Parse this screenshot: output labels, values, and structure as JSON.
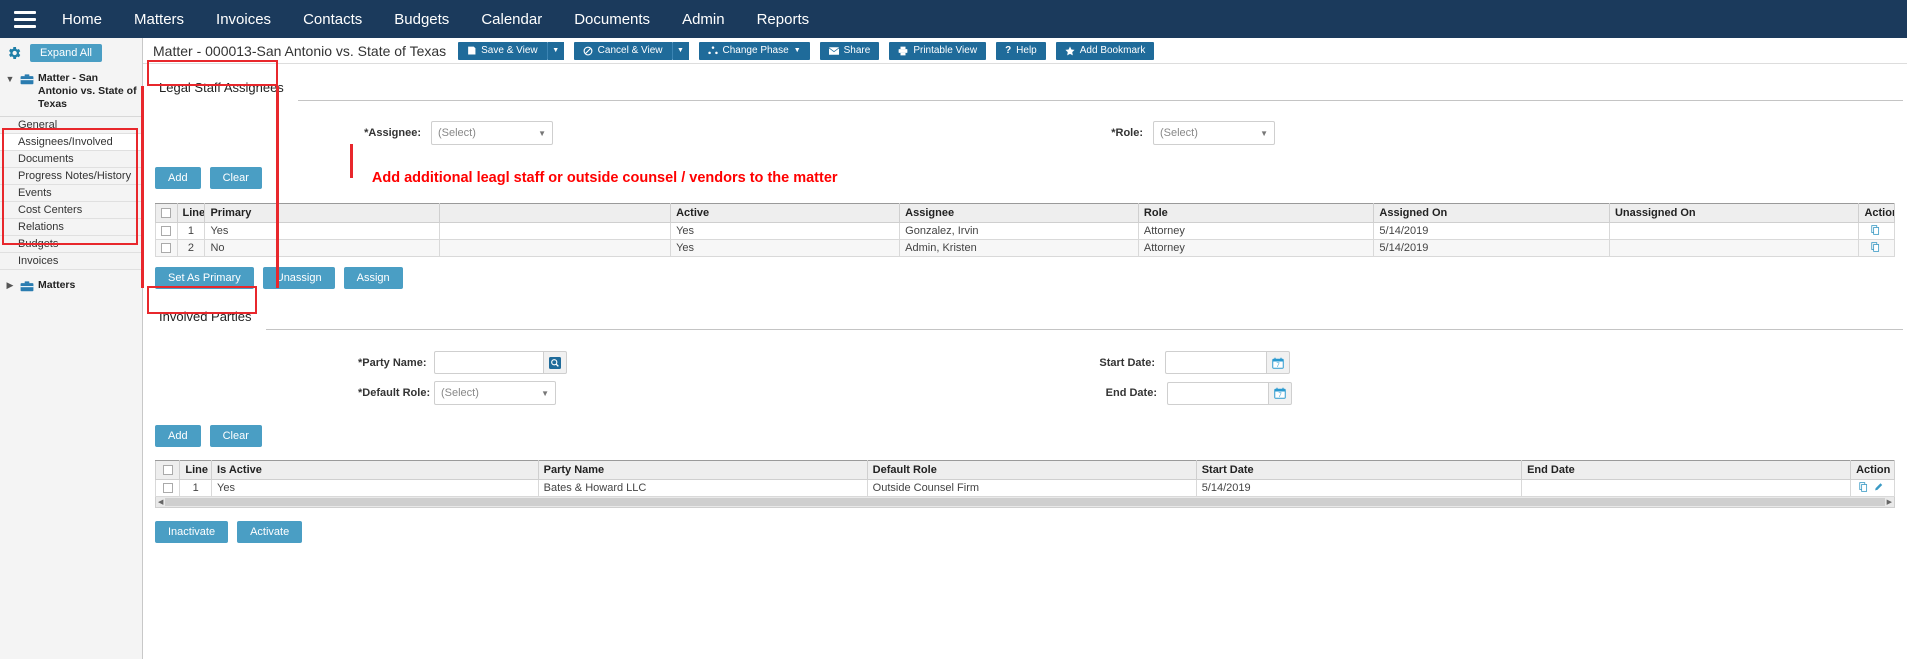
{
  "topnav": {
    "menu_icon": "hamburger-icon",
    "items": [
      {
        "label": "Home"
      },
      {
        "label": "Matters"
      },
      {
        "label": "Invoices"
      },
      {
        "label": "Contacts"
      },
      {
        "label": "Budgets"
      },
      {
        "label": "Calendar"
      },
      {
        "label": "Documents"
      },
      {
        "label": "Admin"
      },
      {
        "label": "Reports"
      }
    ]
  },
  "sidebar": {
    "gear_icon": "gear-icon",
    "expand_all_label": "Expand All",
    "tree": {
      "root_label": "Matter - San Antonio vs. State of Texas",
      "children": [
        {
          "label": "General",
          "active": false
        },
        {
          "label": "Assignees/Involved",
          "active": true
        },
        {
          "label": "Documents",
          "active": false
        },
        {
          "label": "Progress Notes/History",
          "active": false
        },
        {
          "label": "Events",
          "active": false
        },
        {
          "label": "Cost Centers",
          "active": false
        },
        {
          "label": "Relations",
          "active": false
        },
        {
          "label": "Budgets",
          "active": false
        },
        {
          "label": "Invoices",
          "active": false
        }
      ],
      "root2_label": "Matters"
    }
  },
  "header": {
    "title": "Matter - 000013-San Antonio vs. State of Texas",
    "buttons": [
      {
        "label": "Save & View",
        "icon": "save-icon",
        "split": true
      },
      {
        "label": "Cancel & View",
        "icon": "cancel-icon",
        "split": true
      },
      {
        "label": "Change Phase",
        "icon": "phase-icon",
        "split": false,
        "inline_caret": true
      },
      {
        "label": "Share",
        "icon": "mail-icon",
        "split": false
      },
      {
        "label": "Printable View",
        "icon": "printer-icon",
        "split": false
      },
      {
        "label": "Help",
        "icon": "question-icon",
        "split": false
      },
      {
        "label": "Add Bookmark",
        "icon": "star-icon",
        "split": false
      }
    ]
  },
  "legal_staff": {
    "section_title": "Legal Staff Assignees",
    "assignee_label": "*Assignee:",
    "assignee_value": "(Select)",
    "role_label": "*Role:",
    "role_value": "(Select)",
    "add_label": "Add",
    "clear_label": "Clear",
    "annotation": "Add additional leagl staff or outside counsel / vendors to the matter",
    "grid": {
      "columns": [
        "",
        "Line",
        "Primary",
        "",
        "Active",
        "Assignee",
        "Role",
        "Assigned On",
        "Unassigned On",
        "Action"
      ],
      "rows": [
        {
          "line": "1",
          "primary": "Yes",
          "blank": "",
          "active": "Yes",
          "assignee": "Gonzalez, Irvin",
          "role": "Attorney",
          "assigned_on": "5/14/2019",
          "unassigned_on": "",
          "action_icon": "copy-icon"
        },
        {
          "line": "2",
          "primary": "No",
          "blank": "",
          "active": "Yes",
          "assignee": "Admin, Kristen",
          "role": "Attorney",
          "assigned_on": "5/14/2019",
          "unassigned_on": "",
          "action_icon": "copy-icon"
        }
      ]
    },
    "footer_buttons": [
      {
        "label": "Set As Primary"
      },
      {
        "label": "Unassign"
      },
      {
        "label": "Assign"
      }
    ]
  },
  "involved_parties": {
    "section_title": "Involved Parties",
    "party_name_label": "*Party Name:",
    "party_name_value": "",
    "party_search_icon": "search-icon",
    "default_role_label": "*Default Role:",
    "default_role_value": "(Select)",
    "start_date_label": "Start Date:",
    "start_date_value": "",
    "end_date_label": "End Date:",
    "end_date_value": "",
    "calendar_icon": "calendar-icon",
    "add_label": "Add",
    "clear_label": "Clear",
    "grid": {
      "columns": [
        "",
        "Line",
        "Is Active",
        "Party Name",
        "Default Role",
        "Start Date",
        "End Date",
        "Action"
      ],
      "rows": [
        {
          "line": "1",
          "is_active": "Yes",
          "party_name": "Bates & Howard LLC",
          "default_role": "Outside Counsel Firm",
          "start_date": "5/14/2019",
          "end_date": "",
          "action_icons": [
            "copy-icon",
            "edit-icon"
          ]
        }
      ]
    },
    "footer_buttons": [
      {
        "label": "Inactivate"
      },
      {
        "label": "Activate"
      }
    ]
  },
  "colors": {
    "nav_bg": "#1b3a5c",
    "accent": "#4a9ec4",
    "toolbar_btn": "#1f6b9a",
    "annotation_red": "#ff0000",
    "highlight_box": "#e8272c",
    "link": "#2a78a8"
  }
}
